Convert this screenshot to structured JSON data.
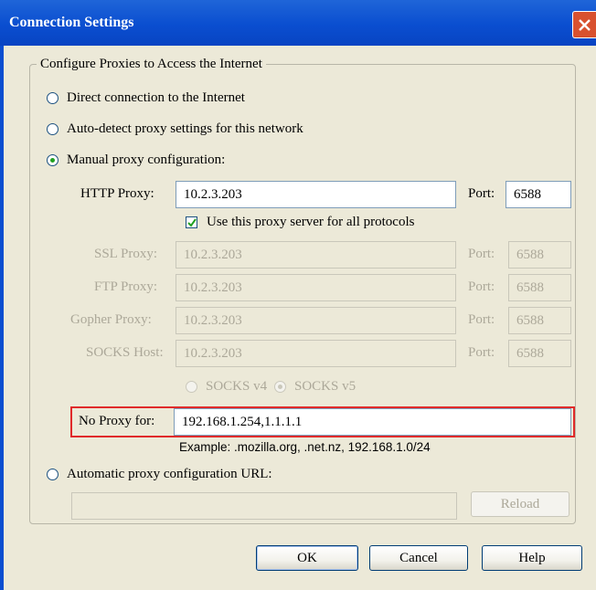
{
  "window": {
    "title": "Connection Settings"
  },
  "group": {
    "legend": "Configure Proxies to Access the Internet"
  },
  "options": {
    "direct": {
      "label": "Direct connection to the Internet",
      "checked": false
    },
    "autodetect": {
      "label": "Auto-detect proxy settings for this network",
      "checked": false
    },
    "manual": {
      "label": "Manual proxy configuration:",
      "checked": true
    },
    "auto_url": {
      "label": "Automatic proxy configuration URL:",
      "checked": false
    }
  },
  "http_proxy": {
    "label": "HTTP Proxy:",
    "value": "10.2.3.203",
    "port_label": "Port:",
    "port": "6588"
  },
  "use_all": {
    "label": "Use this proxy server for all protocols",
    "checked": true
  },
  "ssl_proxy": {
    "label": "SSL Proxy:",
    "value": "10.2.3.203",
    "port_label": "Port:",
    "port": "6588"
  },
  "ftp_proxy": {
    "label": "FTP Proxy:",
    "value": "10.2.3.203",
    "port_label": "Port:",
    "port": "6588"
  },
  "gopher_proxy": {
    "label": "Gopher Proxy:",
    "value": "10.2.3.203",
    "port_label": "Port:",
    "port": "6588"
  },
  "socks_host": {
    "label": "SOCKS Host:",
    "value": "10.2.3.203",
    "port_label": "Port:",
    "port": "6588"
  },
  "socks_version": {
    "v4_label": "SOCKS v4",
    "v5_label": "SOCKS v5",
    "selected": "v5"
  },
  "no_proxy": {
    "label": "No Proxy for:",
    "value": "192.168.1.254,1.1.1.1",
    "example": "Example: .mozilla.org, .net.nz, 192.168.1.0/24"
  },
  "auto_url_value": "",
  "buttons": {
    "reload": "Reload",
    "ok": "OK",
    "cancel": "Cancel",
    "help": "Help"
  },
  "colors": {
    "title_bar": "#0a4ed0",
    "dialog_bg": "#ece9d8",
    "highlight": "#e02a2a"
  }
}
